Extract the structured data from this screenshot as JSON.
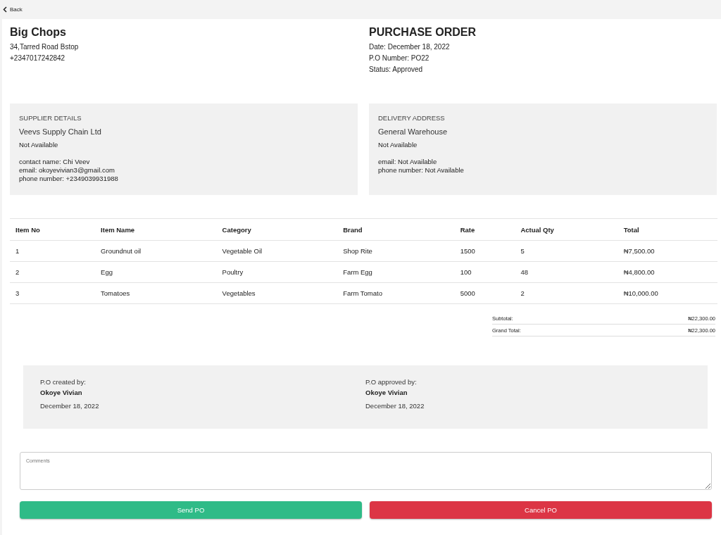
{
  "back": {
    "label": "Back"
  },
  "company": {
    "name": "Big Chops",
    "address": "34,Tarred Road Bstop",
    "phone": "+2347017242842"
  },
  "order": {
    "title": "PURCHASE ORDER",
    "lines": [
      "Date: December 18, 2022",
      "P.O Number: PO22",
      "Status: Approved"
    ]
  },
  "cards": [
    {
      "heading": "SUPPLIER DETAILS",
      "name": "Veevs Supply Chain Ltd",
      "address": "Not Available",
      "details": [
        "contact name: Chi Veev",
        "email: okoyevivian3@gmail.com",
        "phone number: +2349039931988"
      ]
    },
    {
      "heading": "DELIVERY ADDRESS",
      "name": "General Warehouse",
      "address": "Not Available",
      "details": [
        "email: Not Available",
        "phone number: Not Available"
      ]
    }
  ],
  "table": {
    "columns": [
      "Item No",
      "Item Name",
      "Category",
      "Brand",
      "Rate",
      "Actual Qty",
      "Total"
    ],
    "rows": [
      [
        "1",
        "Groundnut oil",
        "Vegetable Oil",
        "Shop Rite",
        "1500",
        "5",
        "₦7,500.00"
      ],
      [
        "2",
        "Egg",
        "Poultry",
        "Farm Egg",
        "100",
        "48",
        "₦4,800.00"
      ],
      [
        "3",
        "Tomatoes",
        "Vegetables",
        "Farm Tomato",
        "5000",
        "2",
        "₦10,000.00"
      ]
    ]
  },
  "summary": [
    {
      "label": "Subtotal:",
      "value": "₦22,300.00"
    },
    {
      "label": "Grand Total:",
      "value": "₦22,300.00"
    }
  ],
  "signatures": [
    {
      "label": "P.O created by:",
      "name": "Okoye Vivian",
      "date": "December 18, 2022"
    },
    {
      "label": "P.O approved by:",
      "name": "Okoye Vivian",
      "date": "December 18, 2022"
    }
  ],
  "comments": {
    "placeholder": "Comments"
  },
  "buttons": [
    {
      "label": "Send PO",
      "kind": "primary"
    },
    {
      "label": "Cancel PO",
      "kind": "danger"
    }
  ]
}
